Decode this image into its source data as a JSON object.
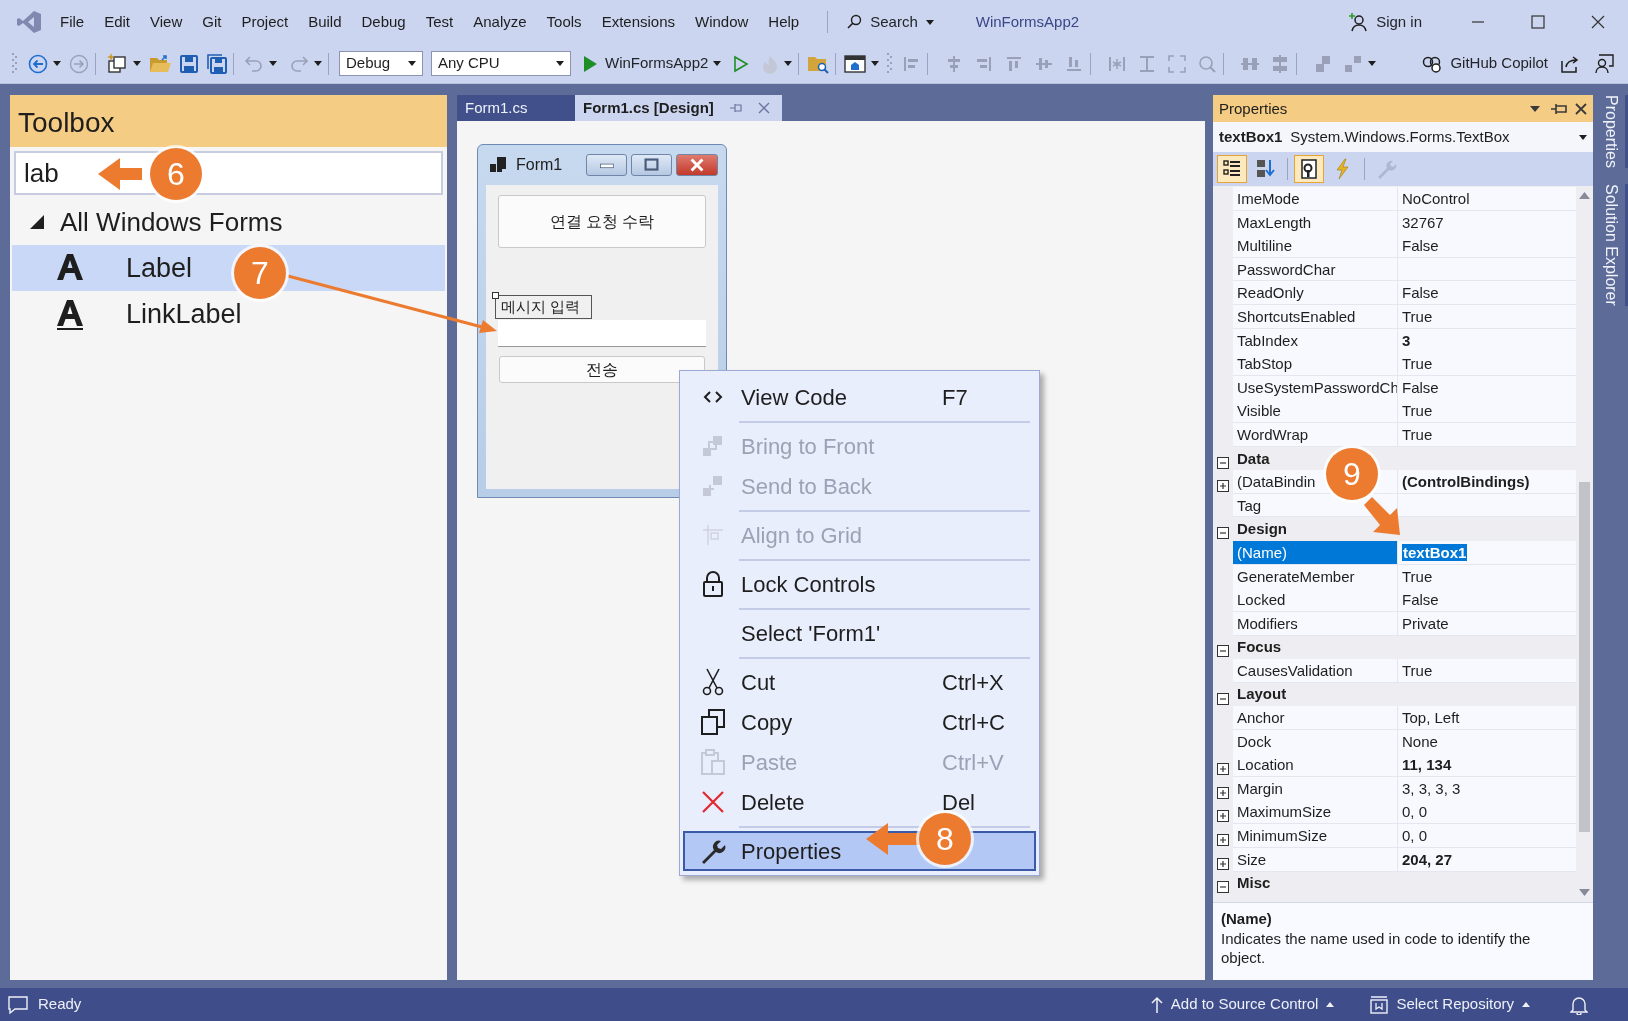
{
  "window": {
    "title": "WinFormsApp2"
  },
  "menu": [
    "File",
    "Edit",
    "View",
    "Git",
    "Project",
    "Build",
    "Debug",
    "Test",
    "Analyze",
    "Tools",
    "Extensions",
    "Window",
    "Help"
  ],
  "search": {
    "label": "Search"
  },
  "account": {
    "label": "Sign in"
  },
  "toolbar": {
    "configuration": "Debug",
    "platform": "Any CPU",
    "startup_project": "WinFormsApp2",
    "copilot": "GitHub Copilot"
  },
  "toolbox": {
    "title": "Toolbox",
    "search_value": "lab",
    "groups": [
      {
        "label": "All Windows Forms",
        "expanded": true,
        "items": [
          {
            "label": "Label",
            "selected": true
          },
          {
            "label": "LinkLabel",
            "selected": false
          }
        ]
      }
    ]
  },
  "document_tabs": [
    {
      "label": "Form1.cs",
      "selected": false
    },
    {
      "label": "Form1.cs [Design]",
      "selected": true
    }
  ],
  "designer_form": {
    "title": "Form1",
    "controls": [
      {
        "kind": "button",
        "text": "연결 요청 수락"
      },
      {
        "kind": "label",
        "text": "메시지 입력"
      },
      {
        "kind": "textbox"
      },
      {
        "kind": "button",
        "text": "전송"
      }
    ]
  },
  "context_menu": [
    {
      "kind": "item",
      "label": "View Code",
      "shortcut": "F7",
      "disabled": false,
      "selected": false
    },
    {
      "kind": "separator"
    },
    {
      "kind": "item",
      "label": "Bring to Front",
      "disabled": true,
      "selected": false
    },
    {
      "kind": "item",
      "label": "Send to Back",
      "disabled": true,
      "selected": false
    },
    {
      "kind": "separator"
    },
    {
      "kind": "item",
      "label": "Align to Grid",
      "disabled": true,
      "selected": false
    },
    {
      "kind": "separator"
    },
    {
      "kind": "item",
      "label": "Lock Controls",
      "disabled": false,
      "selected": false
    },
    {
      "kind": "separator"
    },
    {
      "kind": "item",
      "label": "Select 'Form1'",
      "disabled": false,
      "selected": false
    },
    {
      "kind": "separator"
    },
    {
      "kind": "item",
      "label": "Cut",
      "shortcut": "Ctrl+X",
      "disabled": false,
      "selected": false
    },
    {
      "kind": "item",
      "label": "Copy",
      "shortcut": "Ctrl+C",
      "disabled": false,
      "selected": false
    },
    {
      "kind": "item",
      "label": "Paste",
      "shortcut": "Ctrl+V",
      "disabled": true,
      "selected": false
    },
    {
      "kind": "item",
      "label": "Delete",
      "shortcut": "Del",
      "disabled": false,
      "selected": false
    },
    {
      "kind": "separator"
    },
    {
      "kind": "item",
      "label": "Properties",
      "disabled": false,
      "selected": true
    }
  ],
  "properties": {
    "title": "Properties",
    "object_name": "textBox1",
    "object_type": "System.Windows.Forms.TextBox",
    "view_buttons": [
      {
        "selected": true,
        "disabled": false
      },
      {
        "selected": false,
        "disabled": false
      },
      {
        "selected": true,
        "disabled": false
      },
      {
        "selected": false,
        "disabled": false
      },
      {
        "selected": false,
        "disabled": true
      }
    ],
    "rows": [
      {
        "kind": "property",
        "name": "ImeMode",
        "value": "NoControl",
        "modified": false,
        "selected": false
      },
      {
        "kind": "property",
        "name": "MaxLength",
        "value": "32767",
        "modified": false,
        "selected": false
      },
      {
        "kind": "property",
        "name": "Multiline",
        "value": "False",
        "modified": false,
        "selected": false
      },
      {
        "kind": "property",
        "name": "PasswordChar",
        "selected": false
      },
      {
        "kind": "property",
        "name": "ReadOnly",
        "value": "False",
        "modified": false,
        "selected": false
      },
      {
        "kind": "property",
        "name": "ShortcutsEnabled",
        "value": "True",
        "modified": false,
        "selected": false
      },
      {
        "kind": "property",
        "name": "TabIndex",
        "value": "3",
        "modified": true,
        "selected": false
      },
      {
        "kind": "property",
        "name": "TabStop",
        "value": "True",
        "modified": false,
        "selected": false
      },
      {
        "kind": "property",
        "name": "UseSystemPasswordCh",
        "value": "False",
        "modified": false,
        "selected": false
      },
      {
        "kind": "property",
        "name": "Visible",
        "value": "True",
        "modified": false,
        "selected": false
      },
      {
        "kind": "property",
        "name": "WordWrap",
        "value": "True",
        "modified": false,
        "selected": false
      },
      {
        "kind": "category",
        "name": "Data",
        "expanded": true,
        "selected": false
      },
      {
        "kind": "property",
        "name": "(DataBindin",
        "value": "(ControlBindings)",
        "modified": true,
        "expanded": false,
        "selected": false
      },
      {
        "kind": "property",
        "name": "Tag",
        "selected": false
      },
      {
        "kind": "category",
        "name": "Design",
        "expanded": true,
        "selected": false
      },
      {
        "kind": "property",
        "name": "(Name)",
        "value": "textBox1",
        "modified": true,
        "selected": true
      },
      {
        "kind": "property",
        "name": "GenerateMember",
        "value": "True",
        "modified": false,
        "selected": false
      },
      {
        "kind": "property",
        "name": "Locked",
        "value": "False",
        "modified": false,
        "selected": false
      },
      {
        "kind": "property",
        "name": "Modifiers",
        "value": "Private",
        "modified": false,
        "selected": false
      },
      {
        "kind": "category",
        "name": "Focus",
        "expanded": true,
        "selected": false
      },
      {
        "kind": "property",
        "name": "CausesValidation",
        "value": "True",
        "modified": false,
        "selected": false
      },
      {
        "kind": "category",
        "name": "Layout",
        "expanded": true,
        "selected": false
      },
      {
        "kind": "property",
        "name": "Anchor",
        "value": "Top, Left",
        "modified": false,
        "selected": false
      },
      {
        "kind": "property",
        "name": "Dock",
        "value": "None",
        "modified": false,
        "selected": false
      },
      {
        "kind": "property",
        "name": "Location",
        "value": "11, 134",
        "modified": true,
        "expanded": false,
        "selected": false
      },
      {
        "kind": "property",
        "name": "Margin",
        "value": "3, 3, 3, 3",
        "modified": false,
        "expanded": false,
        "selected": false
      },
      {
        "kind": "property",
        "name": "MaximumSize",
        "value": "0, 0",
        "modified": false,
        "expanded": false,
        "selected": false
      },
      {
        "kind": "property",
        "name": "MinimumSize",
        "value": "0, 0",
        "modified": false,
        "expanded": false,
        "selected": false
      },
      {
        "kind": "property",
        "name": "Size",
        "value": "204, 27",
        "modified": true,
        "expanded": false,
        "selected": false
      },
      {
        "kind": "category",
        "name": "Misc",
        "expanded": true,
        "selected": false
      }
    ],
    "description": {
      "title": "(Name)",
      "text": "Indicates the name used in code to identify the object."
    }
  },
  "side_tabs": [
    "Properties",
    "Solution Explorer"
  ],
  "status_bar": {
    "text": "Ready",
    "source_control": "Add to Source Control",
    "repository": "Select Repository"
  },
  "callouts": [
    "6",
    "7",
    "8",
    "9"
  ]
}
